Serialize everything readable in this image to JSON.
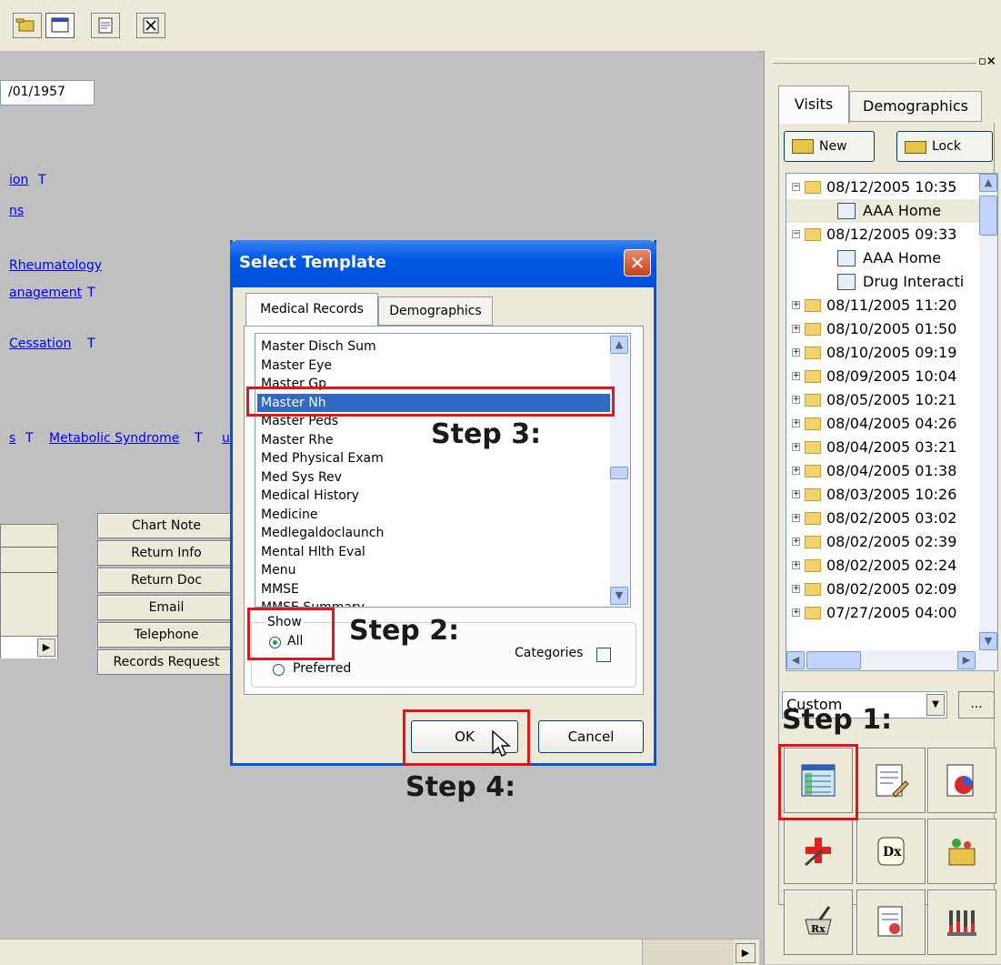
{
  "toolbar": {
    "buttons": [
      "folder-open-icon",
      "window-icon",
      "print-icon",
      "close-window-icon"
    ]
  },
  "main": {
    "dob_value": "/01/1957",
    "links": [
      "ion",
      "ns",
      "Rheumatology",
      "anagement",
      "Cessation",
      "s",
      "Metabolic Syndrome",
      "u"
    ],
    "t_marker": "T",
    "side_buttons": [
      "Chart Note",
      "Return Info",
      "Return Doc",
      "Email",
      "Telephone",
      "Records Request"
    ]
  },
  "panel": {
    "tabs": [
      "Visits",
      "Demographics"
    ],
    "new_label": "New",
    "lock_label": "Lock",
    "tree": [
      {
        "label": "08/12/2005 10:35",
        "type": "folder",
        "expanded": true
      },
      {
        "label": "AAA Home",
        "type": "doc"
      },
      {
        "label": "08/12/2005 09:33",
        "type": "folder",
        "expanded": true
      },
      {
        "label": "AAA Home",
        "type": "doc"
      },
      {
        "label": "Drug Interacti",
        "type": "doc"
      },
      {
        "label": "08/11/2005 11:20",
        "type": "folder"
      },
      {
        "label": "08/10/2005 01:50",
        "type": "folder"
      },
      {
        "label": "08/10/2005 09:19",
        "type": "folder"
      },
      {
        "label": "08/09/2005 10:04",
        "type": "folder"
      },
      {
        "label": "08/05/2005 10:21",
        "type": "folder"
      },
      {
        "label": "08/04/2005 04:26",
        "type": "folder"
      },
      {
        "label": "08/04/2005 03:21",
        "type": "folder"
      },
      {
        "label": "08/04/2005 01:38",
        "type": "folder"
      },
      {
        "label": "08/03/2005 10:26",
        "type": "folder"
      },
      {
        "label": "08/02/2005 03:02",
        "type": "folder"
      },
      {
        "label": "08/02/2005 02:39",
        "type": "folder"
      },
      {
        "label": "08/02/2005 02:24",
        "type": "folder"
      },
      {
        "label": "08/02/2005 02:09",
        "type": "folder"
      },
      {
        "label": "07/27/2005 04:00",
        "type": "folder"
      }
    ],
    "combo_value": "Custom",
    "more_label": "...",
    "icon_buttons": [
      "template-icon",
      "edit-note-icon",
      "graph-icon",
      "medical-cross-icon",
      "rx-scroll-icon",
      "lab-icon",
      "mortar-pestle-icon",
      "referral-icon",
      "test-tubes-icon"
    ]
  },
  "dialog": {
    "title": "Select Template",
    "tabs": [
      "Medical Records",
      "Demographics"
    ],
    "items": [
      "Master Disch Sum",
      "Master Eye",
      "Master Gp",
      "Master Nh",
      "Master Peds",
      "Master Rhe",
      "Med Physical Exam",
      "Med Sys Rev",
      "Medical History",
      "Medicine",
      "Medlegaldoclaunch",
      "Mental Hlth Eval",
      "Menu",
      "MMSE",
      "MMSE Summary"
    ],
    "selected_item": "Master Nh",
    "show_label": "Show",
    "radio_all": "All",
    "radio_preferred": "Preferred",
    "categories_label": "Categories",
    "ok_label": "OK",
    "cancel_label": "Cancel"
  },
  "annotations": {
    "step1": "Step 1:",
    "step2": "Step 2:",
    "step3": "Step 3:",
    "step4": "Step 4:",
    "highlight_color": "#e4141b"
  }
}
